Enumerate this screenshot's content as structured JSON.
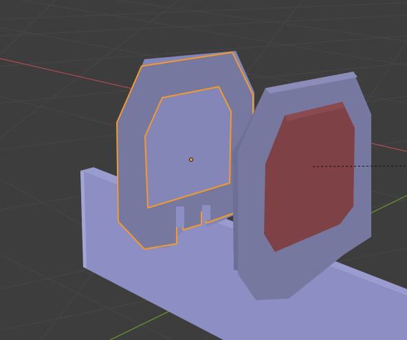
{
  "viewport": {
    "background": "#3d3d3d",
    "grid_color": "#474747",
    "x_axis_color": "#b04a55",
    "y_axis_color": "#6a9a2c",
    "selection_outline_color": "#f39a2c",
    "origin_color": "#f39a2c",
    "rail_color": "#8d8fc4",
    "frame_color": "#76789f",
    "lens_color": "#7d4146"
  },
  "scene": {
    "objects": [
      {
        "name": "rail",
        "selected": false
      },
      {
        "name": "selected-frame",
        "selected": true
      },
      {
        "name": "mounted-frame",
        "selected": false
      },
      {
        "name": "red-lens",
        "selected": false
      }
    ]
  }
}
